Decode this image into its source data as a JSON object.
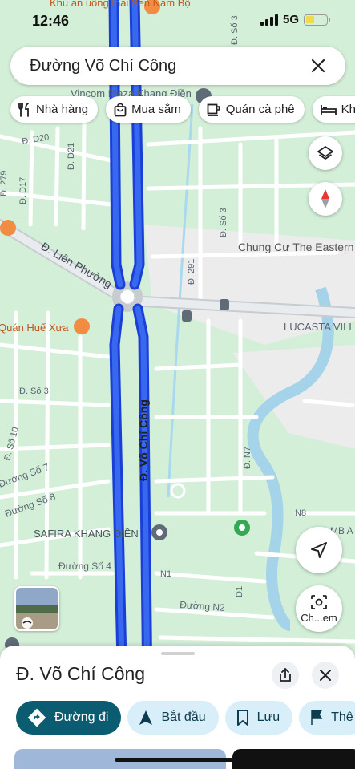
{
  "status_bar": {
    "time": "12:46",
    "network": "5G"
  },
  "search": {
    "query": "Đường Võ Chí Công"
  },
  "category_chips": [
    {
      "label": "Nhà hàng",
      "icon": "restaurant-icon"
    },
    {
      "label": "Mua sắm",
      "icon": "shopping-bag-icon"
    },
    {
      "label": "Quán cà phê",
      "icon": "coffee-icon"
    },
    {
      "label": "Khá",
      "icon": "hotel-bed-icon"
    }
  ],
  "map": {
    "labels": {
      "top_poi": "Khu ăn uống thái Sen Nam Bộ",
      "vincom": "Vincom Plaza Khang Điền",
      "d20": "Đ. D20",
      "d21": "Đ. D21",
      "d17": "Đ. D17",
      "d279": "Đ. 279",
      "so3_top": "Đ. Số 3",
      "lien_phuong": "Đ. Liên Phường",
      "chung_cu": "Chung Cư The Eastern",
      "d291": "Đ. 291",
      "lucasta": "LUCASTA VILL",
      "quan_hue": "Quán Huế Xưa",
      "so3_left": "Đ. Số 3",
      "so10": "Đ. Số 10",
      "duong_so7": "Đường Số 7",
      "duong_so8": "Đường Số 8",
      "vo_chi_cong": "Đ. Võ Chí Công",
      "n7": "Đ. N7",
      "n8": "N8",
      "mb": "MB A",
      "safira": "SAFIRA KHANG ĐIỀN",
      "duong_so4": "Đường Số 4",
      "n1": "N1",
      "d1": "D1",
      "duong_n2": "Đường N2",
      "d3_top": "Đ. Số 3"
    }
  },
  "controls": {
    "layers": "layers-icon",
    "compass": "compass-icon",
    "location": "my-location-icon",
    "lens_label": "Ch...em"
  },
  "sheet": {
    "title": "Đ. Võ Chí Công",
    "actions": [
      {
        "label": "Đường đi",
        "icon": "directions-icon",
        "primary": true
      },
      {
        "label": "Bắt đầu",
        "icon": "navigation-icon",
        "primary": false
      },
      {
        "label": "Lưu",
        "icon": "bookmark-icon",
        "primary": false
      },
      {
        "label": "Thê",
        "icon": "flag-icon",
        "primary": false
      }
    ]
  }
}
